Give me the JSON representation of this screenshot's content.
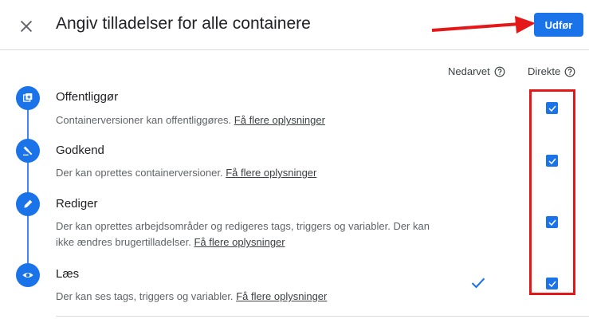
{
  "header": {
    "title": "Angiv tilladelser for alle containere",
    "apply_label": "Udfør"
  },
  "columns": {
    "inherited": "Nedarvet",
    "direct": "Direkte"
  },
  "permissions": [
    {
      "title": "Offentliggør",
      "description": "Containerversioner kan offentliggøres.",
      "link": "Få flere oplysninger",
      "icon": "publish-icon",
      "direct_checked": true,
      "inherited_checked": false
    },
    {
      "title": "Godkend",
      "description": "Der kan oprettes containerversioner.",
      "link": "Få flere oplysninger",
      "icon": "gavel-icon",
      "direct_checked": true,
      "inherited_checked": false
    },
    {
      "title": "Rediger",
      "description": "Der kan oprettes arbejdsområder og redigeres tags, triggers og variabler. Der kan ikke ændres brugertilladelser.",
      "link": "Få flere oplysninger",
      "icon": "pencil-icon",
      "direct_checked": true,
      "inherited_checked": false
    },
    {
      "title": "Læs",
      "description": "Der kan ses tags, triggers og variabler.",
      "link": "Få flere oplysninger",
      "icon": "eye-icon",
      "direct_checked": true,
      "inherited_checked": true
    }
  ],
  "colors": {
    "accent": "#1a73e8",
    "annotation": "#e41818"
  }
}
